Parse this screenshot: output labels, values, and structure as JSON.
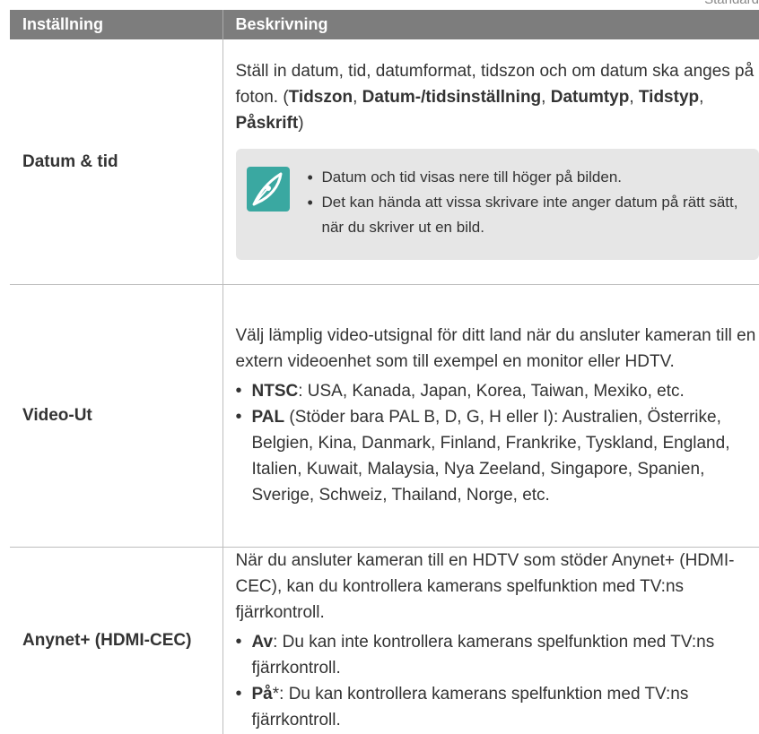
{
  "corner_label": "Standard",
  "table": {
    "header_setting": "Inställning",
    "header_description": "Beskrivning",
    "rows": [
      {
        "name": "Datum & tid",
        "text_before": "Ställ in datum, tid, datumformat, tidszon och om datum ska anges på foton. (",
        "bold_items": [
          "Tidszon",
          "Datum-/tidsinställning",
          "Datumtyp",
          "Tidstyp",
          "Påskrift"
        ],
        "separator": ", ",
        "text_after": ")",
        "notes": [
          "Datum och tid visas nere till höger på bilden.",
          "Det kan hända att vissa skrivare inte anger datum på rätt sätt, när du skriver ut en bild."
        ],
        "note_icon": "pen-note-icon"
      },
      {
        "name": "Video-Ut",
        "intro": "Välj lämplig video-utsignal för ditt land när du ansluter kameran till en extern videoenhet som till exempel en monitor eller HDTV.",
        "items": [
          {
            "term": "NTSC",
            "rest": ": USA, Kanada, Japan, Korea, Taiwan, Mexiko, etc."
          },
          {
            "term": "PAL",
            "rest": " (Stöder bara PAL B, D, G, H eller I): Australien, Österrike, Belgien, Kina, Danmark, Finland, Frankrike, Tyskland, England, Italien, Kuwait, Malaysia, Nya Zeeland, Singapore, Spanien, Sverige, Schweiz, Thailand, Norge, etc."
          }
        ]
      },
      {
        "name": "Anynet+ (HDMI-CEC)",
        "intro": "När du ansluter kameran till en HDTV som stöder Anynet+ (HDMI-CEC), kan du kontrollera kamerans spelfunktion med TV:ns fjärrkontroll.",
        "items": [
          {
            "term": "Av",
            "rest": ": Du kan inte kontrollera kamerans spelfunktion med TV:ns fjärrkontroll."
          },
          {
            "term": "På",
            "rest": "*: Du kan kontrollera kamerans spelfunktion med TV:ns fjärrkontroll."
          }
        ]
      }
    ]
  }
}
